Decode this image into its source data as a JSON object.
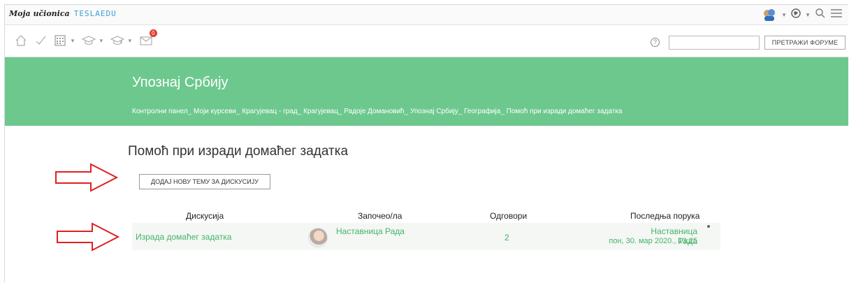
{
  "app": {
    "logo_script": "Moja učionica",
    "logo_brand": "TESLAEDU"
  },
  "nav": {
    "messages_badge": "0",
    "search_placeholder": "",
    "search_button": "ПРЕТРАЖИ ФОРУМЕ"
  },
  "header": {
    "title": "Упознај Србију",
    "breadcrumbs": [
      "Контролни панел",
      "Моји курсеви",
      "Крагујевац - град",
      "Крагујевац",
      "Радоје Домановић",
      "Упознај Србију",
      "Географија",
      "Помоћ при изради домаћег задатка"
    ]
  },
  "main": {
    "title": "Помоћ при изради домаћег задатка",
    "add_topic_button": "ДОДАЈ НОВУ ТЕМУ ЗА ДИСКУСИЈУ",
    "columns": [
      "Дискусија",
      "Започео/ла",
      "Одговори",
      "Последња порука"
    ],
    "rows": [
      {
        "discussion": "Израда домаћег задатка",
        "author": "Наставница Рада",
        "replies": "2",
        "last_author": "Наставница Рада",
        "last_date": "пон, 30. мар 2020., 13:25"
      }
    ]
  },
  "colors": {
    "header_green": "#6dc88e",
    "link_green": "#44b36a",
    "annotation_red": "#e02020"
  }
}
